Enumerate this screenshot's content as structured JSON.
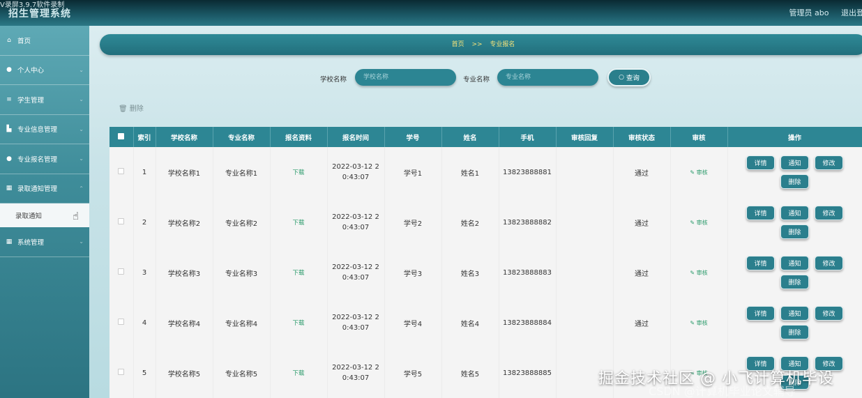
{
  "recorder_text": "V录屏3.9.7软件录制",
  "app_title": "招生管理系统",
  "user": {
    "label": "管理员 abo",
    "logout": "退出登"
  },
  "sidebar": {
    "items": [
      {
        "label": "首页"
      },
      {
        "label": "个人中心"
      },
      {
        "label": "学生管理"
      },
      {
        "label": "专业信息管理"
      },
      {
        "label": "专业报名管理"
      },
      {
        "label": "录取通知管理"
      },
      {
        "label": "录取通知"
      },
      {
        "label": "系统管理"
      }
    ]
  },
  "breadcrumb": {
    "home": "首页",
    "sep": ">>",
    "current": "专业报名"
  },
  "search": {
    "school_label": "学校名称",
    "school_placeholder": "学校名称",
    "major_label": "专业名称",
    "major_placeholder": "专业名称",
    "button": "查询"
  },
  "bulk_delete": "删除",
  "table": {
    "headers": [
      "索引",
      "学校名称",
      "专业名称",
      "报名资料",
      "报名时间",
      "学号",
      "姓名",
      "手机",
      "审核回复",
      "审核状态",
      "审核",
      "操作"
    ],
    "rows": [
      {
        "idx": "1",
        "school": "学校名称1",
        "major": "专业名称1",
        "file": "下载",
        "time1": "2022-03-12 2",
        "time2": "0:43:07",
        "sno": "学号1",
        "name": "姓名1",
        "phone": "13823888881",
        "reply": "",
        "status": "通过",
        "audit": "审核"
      },
      {
        "idx": "2",
        "school": "学校名称2",
        "major": "专业名称2",
        "file": "下载",
        "time1": "2022-03-12 2",
        "time2": "0:43:07",
        "sno": "学号2",
        "name": "姓名2",
        "phone": "13823888882",
        "reply": "",
        "status": "通过",
        "audit": "审核"
      },
      {
        "idx": "3",
        "school": "学校名称3",
        "major": "专业名称3",
        "file": "下载",
        "time1": "2022-03-12 2",
        "time2": "0:43:07",
        "sno": "学号3",
        "name": "姓名3",
        "phone": "13823888883",
        "reply": "",
        "status": "通过",
        "audit": "审核"
      },
      {
        "idx": "4",
        "school": "学校名称4",
        "major": "专业名称4",
        "file": "下载",
        "time1": "2022-03-12 2",
        "time2": "0:43:07",
        "sno": "学号4",
        "name": "姓名4",
        "phone": "13823888884",
        "reply": "",
        "status": "通过",
        "audit": "审核"
      },
      {
        "idx": "5",
        "school": "学校名称5",
        "major": "专业名称5",
        "file": "下载",
        "time1": "2022-03-12 2",
        "time2": "0:43:07",
        "sno": "学号5",
        "name": "姓名5",
        "phone": "13823888885",
        "reply": "",
        "status": "",
        "audit": "审核"
      }
    ],
    "ops": {
      "detail": "详情",
      "notify": "通知",
      "edit": "修改",
      "delete": "删除"
    }
  },
  "watermark": {
    "line1": "掘金技术社区 @ 小飞计算机毕设",
    "line2": "CSDN @计算机毕业论文辅导"
  }
}
